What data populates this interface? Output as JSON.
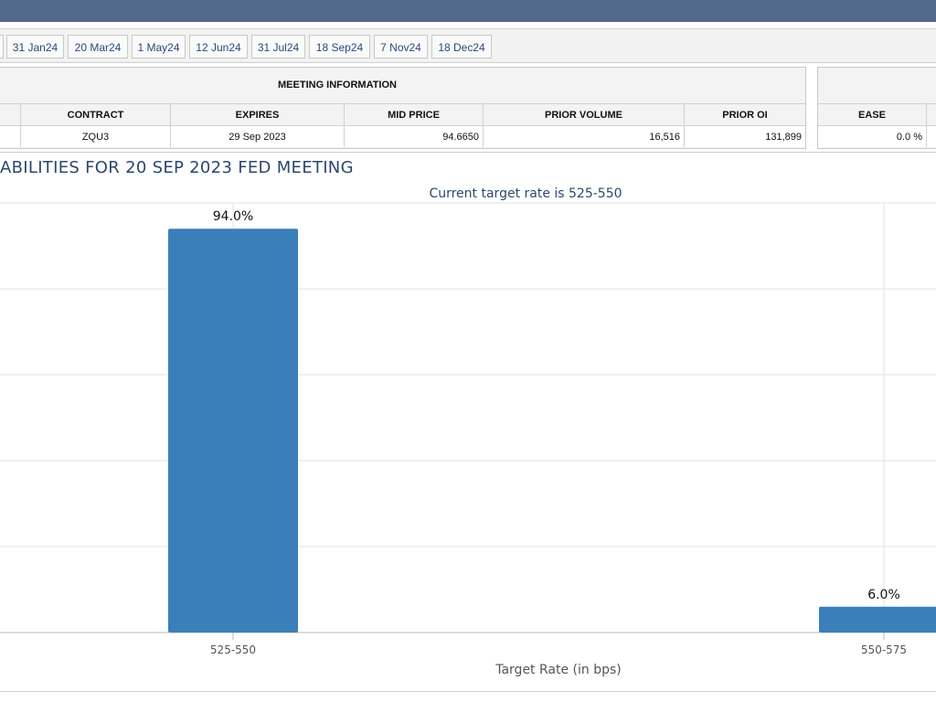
{
  "meeting_tabs": [
    "31 Jan24",
    "20 Mar24",
    "1 May24",
    "12 Jun24",
    "31 Jul24",
    "18 Sep24",
    "7 Nov24",
    "18 Dec24"
  ],
  "meeting_info": {
    "title": "MEETING INFORMATION",
    "headers": {
      "contract": "CONTRACT",
      "expires": "EXPIRES",
      "mid_price": "MID PRICE",
      "prior_volume": "PRIOR VOLUME",
      "prior_oi": "PRIOR OI"
    },
    "row": {
      "contract": "ZQU3",
      "expires": "29 Sep 2023",
      "mid_price": "94.6650",
      "prior_volume": "16,516",
      "prior_oi": "131,899"
    }
  },
  "probabilities": {
    "headers": {
      "ease": "EASE"
    },
    "row": {
      "ease": "0.0 %"
    }
  },
  "chart_data": {
    "type": "bar",
    "title": "ABILITIES FOR 20 SEP 2023 FED MEETING",
    "subtitle": "Current target rate is 525-550",
    "xlabel": "Target Rate (in bps)",
    "ylabel": "",
    "categories": [
      "525-550",
      "550-575"
    ],
    "values": [
      94.0,
      6.0
    ],
    "data_labels": [
      "94.0%",
      "6.0%"
    ],
    "ylim": [
      0,
      100
    ],
    "grid": true,
    "bar_color": "#3a7fba"
  },
  "colors": {
    "topbar": "#53698b",
    "title_text": "#2c4770"
  }
}
